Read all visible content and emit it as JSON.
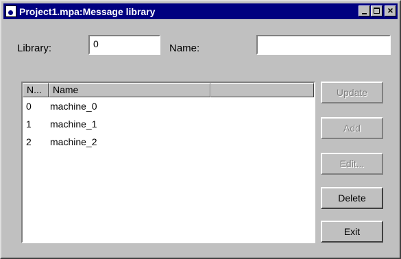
{
  "window": {
    "title": "Project1.mpa:Message library",
    "icon": "document-icon"
  },
  "form": {
    "library_label": "Library:",
    "library_value": "0",
    "name_label": "Name:",
    "name_value": ""
  },
  "list": {
    "columns": [
      "N...",
      "Name",
      ""
    ],
    "rows": [
      {
        "num": "0",
        "name": "machine_0"
      },
      {
        "num": "1",
        "name": "machine_1"
      },
      {
        "num": "2",
        "name": "machine_2"
      }
    ]
  },
  "buttons": {
    "update": {
      "label": "Update",
      "enabled": false
    },
    "add": {
      "label": "Add",
      "enabled": false
    },
    "edit": {
      "label": "Edit...",
      "enabled": false
    },
    "delete": {
      "label": "Delete",
      "enabled": true
    },
    "exit": {
      "label": "Exit",
      "enabled": true
    }
  }
}
